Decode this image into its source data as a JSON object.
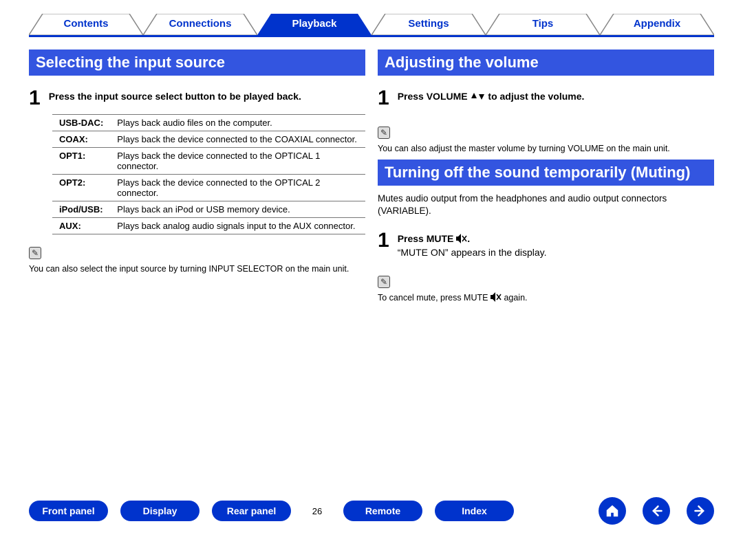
{
  "nav": {
    "tabs": [
      {
        "label": "Contents",
        "active": false
      },
      {
        "label": "Connections",
        "active": false
      },
      {
        "label": "Playback",
        "active": true
      },
      {
        "label": "Settings",
        "active": false
      },
      {
        "label": "Tips",
        "active": false
      },
      {
        "label": "Appendix",
        "active": false
      }
    ]
  },
  "left": {
    "heading": "Selecting the input source",
    "step_num": "1",
    "step_text": "Press the input source select button to be played back.",
    "sources": [
      {
        "k": "USB-DAC:",
        "v": "Plays back audio files on the computer."
      },
      {
        "k": "COAX:",
        "v": "Plays back the device connected to the COAXIAL connector."
      },
      {
        "k": "OPT1:",
        "v": "Plays back the device connected to the OPTICAL 1 connector."
      },
      {
        "k": "OPT2:",
        "v": "Plays back the device connected to the OPTICAL 2 connector."
      },
      {
        "k": "iPod/USB:",
        "v": "Plays back an iPod or USB memory device."
      },
      {
        "k": "AUX:",
        "v": "Plays back analog audio signals input to the AUX connector."
      }
    ],
    "tip": "You can also select the input source by turning INPUT SELECTOR on the main unit."
  },
  "right": {
    "heading1": "Adjusting the volume",
    "vol_step_num": "1",
    "vol_step_text_a": "Press VOLUME ",
    "vol_step_text_b": " to adjust the volume.",
    "vol_tip": "You can also adjust the master volume by turning VOLUME on the main unit.",
    "heading2": "Turning off the sound temporarily (Muting)",
    "mute_intro": "Mutes audio output from the headphones and audio output connectors (VARIABLE).",
    "mute_step_num": "1",
    "mute_step_text": "Press MUTE ",
    "mute_step_sub": "“MUTE ON” appears in the display.",
    "mute_tip_a": "To cancel mute, press MUTE ",
    "mute_tip_b": " again."
  },
  "footer": {
    "links": [
      "Front panel",
      "Display",
      "Rear panel"
    ],
    "page": "26",
    "links2": [
      "Remote",
      "Index"
    ]
  }
}
